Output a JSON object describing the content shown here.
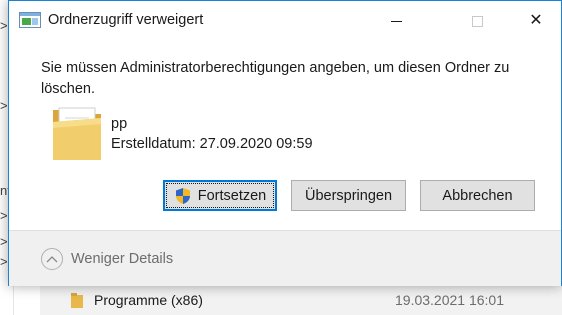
{
  "dialog": {
    "title": "Ordnerzugriff verweigert",
    "message": "Sie müssen Administratorberechtigungen angeben, um diesen Ordner zu löschen.",
    "item": {
      "name": "pp",
      "created": "Erstelldatum: 27.09.2020 09:59"
    },
    "buttons": {
      "continue": "Fortsetzen",
      "skip": "Überspringen",
      "cancel": "Abbrechen"
    },
    "details_toggle": "Weniger Details",
    "window_controls": {
      "minimize_icon": "minimize-icon",
      "maximize_icon": "maximize-icon",
      "close_icon": "close-icon"
    }
  },
  "background": {
    "left_glyphs": [
      ">",
      ">",
      "nt",
      ">",
      ">",
      ">"
    ],
    "row": {
      "name": "Programme (x86)",
      "date": "19.03.2021 16:01"
    }
  },
  "colors": {
    "accent": "#0078d7",
    "border": "#1883d7",
    "folder": "#e8b94a",
    "footer": "#f0f0f0"
  }
}
